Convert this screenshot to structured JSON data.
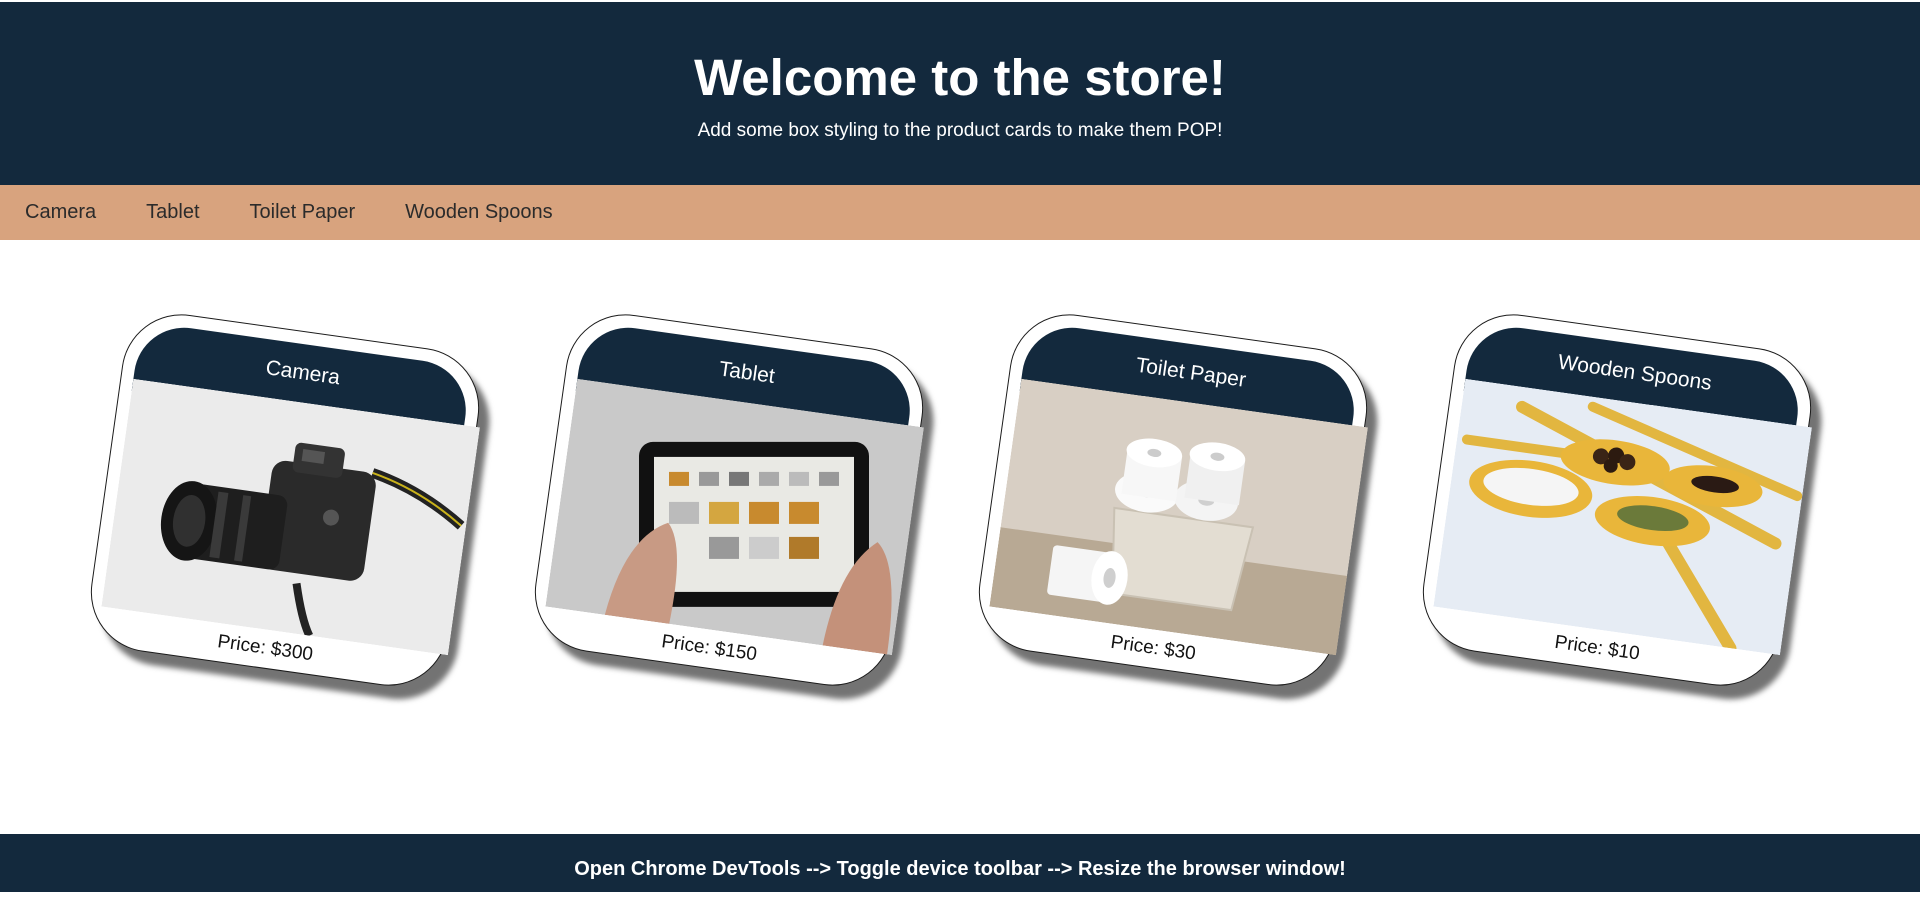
{
  "header": {
    "title": "Welcome to the store!",
    "subtitle": "Add some box styling to the product cards to make them POP!"
  },
  "nav": {
    "items": [
      "Camera",
      "Tablet",
      "Toilet Paper",
      "Wooden Spoons"
    ]
  },
  "products": [
    {
      "name": "Camera",
      "price": "Price: $300",
      "image_icon": "camera-photo"
    },
    {
      "name": "Tablet",
      "price": "Price: $150",
      "image_icon": "tablet-photo"
    },
    {
      "name": "Toilet Paper",
      "price": "Price: $30",
      "image_icon": "toilet-paper-photo"
    },
    {
      "name": "Wooden Spoons",
      "price": "Price: $10",
      "image_icon": "wooden-spoons-photo"
    }
  ],
  "footer": {
    "text": "Open Chrome DevTools --> Toggle device toolbar --> Resize the browser window!"
  },
  "colors": {
    "header_bg": "#13293d",
    "nav_bg": "#d8a37e",
    "card_title_bg": "#13293d"
  }
}
